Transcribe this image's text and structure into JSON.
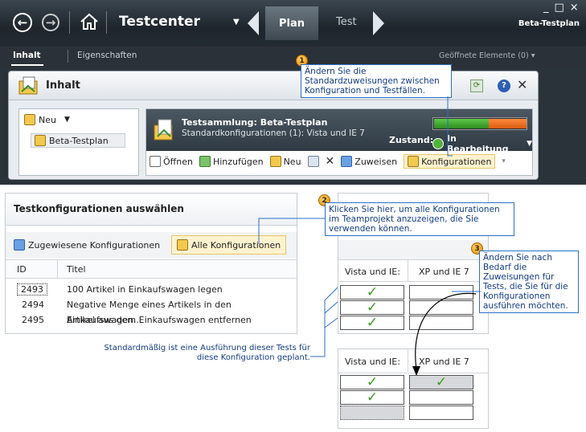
{
  "title_bar": {
    "app_title": "Testcenter",
    "tab_plan": "Plan",
    "tab_test": "Test",
    "plan_name": "Beta-Testplan",
    "window_controls": [
      "_",
      "□",
      "×"
    ]
  },
  "sub_nav": {
    "tab_inhalt": "Inhalt",
    "tab_eigenschaften": "Eigenschaften",
    "opened_items": "Geöffnete Elemente (0)"
  },
  "content_card": {
    "header": "Inhalt",
    "tree_new": "Neu",
    "tree_item": "Beta-Testplan",
    "suite_title": "Testsammlung: Beta-Testplan",
    "suite_subtitle": "Standardkonfigurationen (1): Vista und IE 7",
    "state_label": "Zustand:",
    "state_value": "In Bearbeitung",
    "toolbar": {
      "open": "Öffnen",
      "add": "Hinzufügen",
      "new": "Neu",
      "assign": "Zuweisen",
      "configurations": "Konfigurationen"
    }
  },
  "callouts": {
    "c1_num": "1",
    "c1_text": "Ändern Sie die Standardzuweisungen zwischen Konfiguration und Testfällen.",
    "c2_num": "2",
    "c2_text": "Klicken Sie hier, um alle Konfigurationen im Teamprojekt anzuzeigen, die Sie verwenden können.",
    "c3_num": "3",
    "c3_text": "Ändern Sie nach Bedarf die Zuweisungen für Tests, die Sie für die Konfigurationen ausführen möchten.",
    "default_note": "Standardmäßig ist eine Ausführung dieser Tests für diese Konfiguration geplant."
  },
  "select_panel": {
    "title": "Testkonfigurationen auswählen",
    "btn_assigned": "Zugewiesene Konfigurationen",
    "btn_all": "Alle Konfigurationen",
    "col_id": "ID",
    "col_title": "Titel",
    "rows": [
      {
        "id": "2493",
        "title": "100 Artikel in Einkaufswagen legen"
      },
      {
        "id": "2494",
        "title": "Negative Menge eines Artikels in den Einkaufswagen..."
      },
      {
        "id": "2495",
        "title": "Artikel aus dem Einkaufswagen entfernen"
      }
    ]
  },
  "config_grid": {
    "col1": "Vista und IE:",
    "col2": "XP und IE 7",
    "check": "✓"
  },
  "colors": {
    "accent_orange": "#e58a00",
    "callout_border": "#2a6fc9",
    "check_green": "#3b9a1f"
  }
}
